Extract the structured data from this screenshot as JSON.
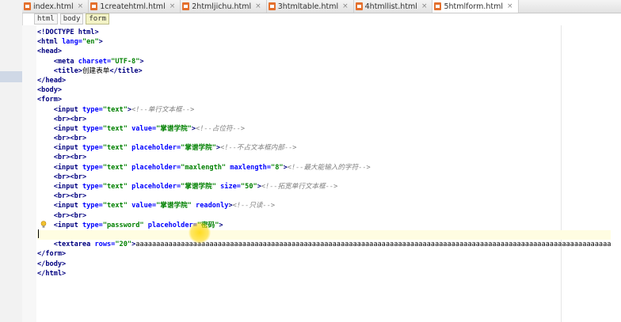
{
  "tabs": [
    {
      "label": "index.html",
      "active": false
    },
    {
      "label": "1createhtml.html",
      "active": false
    },
    {
      "label": "2htmljichu.html",
      "active": false
    },
    {
      "label": "3htmltable.html",
      "active": false
    },
    {
      "label": "4htmllist.html",
      "active": false
    },
    {
      "label": "5htmlform.html",
      "active": true
    }
  ],
  "breadcrumbs": [
    {
      "label": "html",
      "active": false
    },
    {
      "label": "body",
      "active": false
    },
    {
      "label": "form",
      "active": true
    }
  ],
  "code_lines": [
    "<!DOCTYPE html>",
    "<html lang=\"en\">",
    "<head>",
    "    <meta charset=\"UTF-8\">",
    "    <title>创建表单</title>",
    "</head>",
    "<body>",
    "<form>",
    "    <input type=\"text\"><!--单行文本框-->",
    "    <br><br>",
    "    <input type=\"text\" value=\"掌谱学院\"><!--占位符-->",
    "    <br><br>",
    "    <input type=\"text\" placeholder=\"掌谱学院\"><!--不占文本框内部-->",
    "    <br><br>",
    "    <input type=\"text\" placeholder=\"maxlength\" maxlength=\"8\"><!--最大能输入的字符-->",
    "    <br><br>",
    "    <input type=\"text\" placeholder=\"掌谱学院\" size=\"50\"><!--拓宽单行文本框-->",
    "    <br><br>",
    "    <input type=\"text\" value=\"掌谱学院\" readonly><!--只读-->",
    "    <br><br>",
    "    <input type=\"password\" placeholder=\"密码\">",
    "",
    "    <textarea rows=\"20\">aaaaaaaaaaaaaaaaaaaaaaaaaaaaaaaaaaaaaaaaaaaaaaaaaaaaaaaaaaaaaaaaaaaaaaaaaaaaaaaaaaaaaaaaaaaaaaaaaaaaaaaaaaaaaaaaaaaa",
    "</form>",
    "</body>",
    "</html>"
  ],
  "caret_line_index": 21,
  "colors": {
    "tag": "#000080",
    "attribute": "#0000ff",
    "value": "#008000",
    "comment": "#808080",
    "caret_line": "#fffde2",
    "file_icon": "#e4702d"
  },
  "icons": {
    "tab_file": "html-file-icon",
    "tab_close": "close-icon",
    "gutter_hint": "lightbulb-icon"
  }
}
